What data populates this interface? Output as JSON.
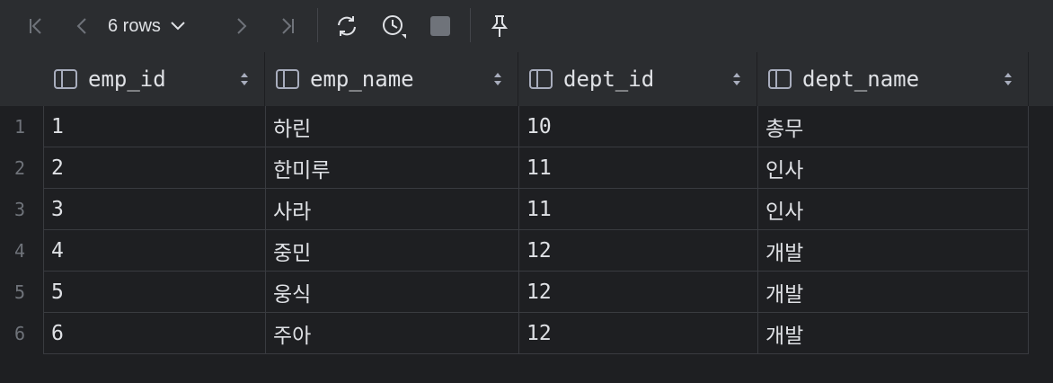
{
  "toolbar": {
    "rows_label": "6 rows"
  },
  "columns": [
    {
      "label": "emp_id"
    },
    {
      "label": "emp_name"
    },
    {
      "label": "dept_id"
    },
    {
      "label": "dept_name"
    }
  ],
  "rows": [
    {
      "num": "1",
      "cells": [
        "1",
        "하린",
        "10",
        "총무"
      ]
    },
    {
      "num": "2",
      "cells": [
        "2",
        "한미루",
        "11",
        "인사"
      ]
    },
    {
      "num": "3",
      "cells": [
        "3",
        "사라",
        "11",
        "인사"
      ]
    },
    {
      "num": "4",
      "cells": [
        "4",
        "중민",
        "12",
        "개발"
      ]
    },
    {
      "num": "5",
      "cells": [
        "5",
        "웅식",
        "12",
        "개발"
      ]
    },
    {
      "num": "6",
      "cells": [
        "6",
        "주아",
        "12",
        "개발"
      ]
    }
  ]
}
